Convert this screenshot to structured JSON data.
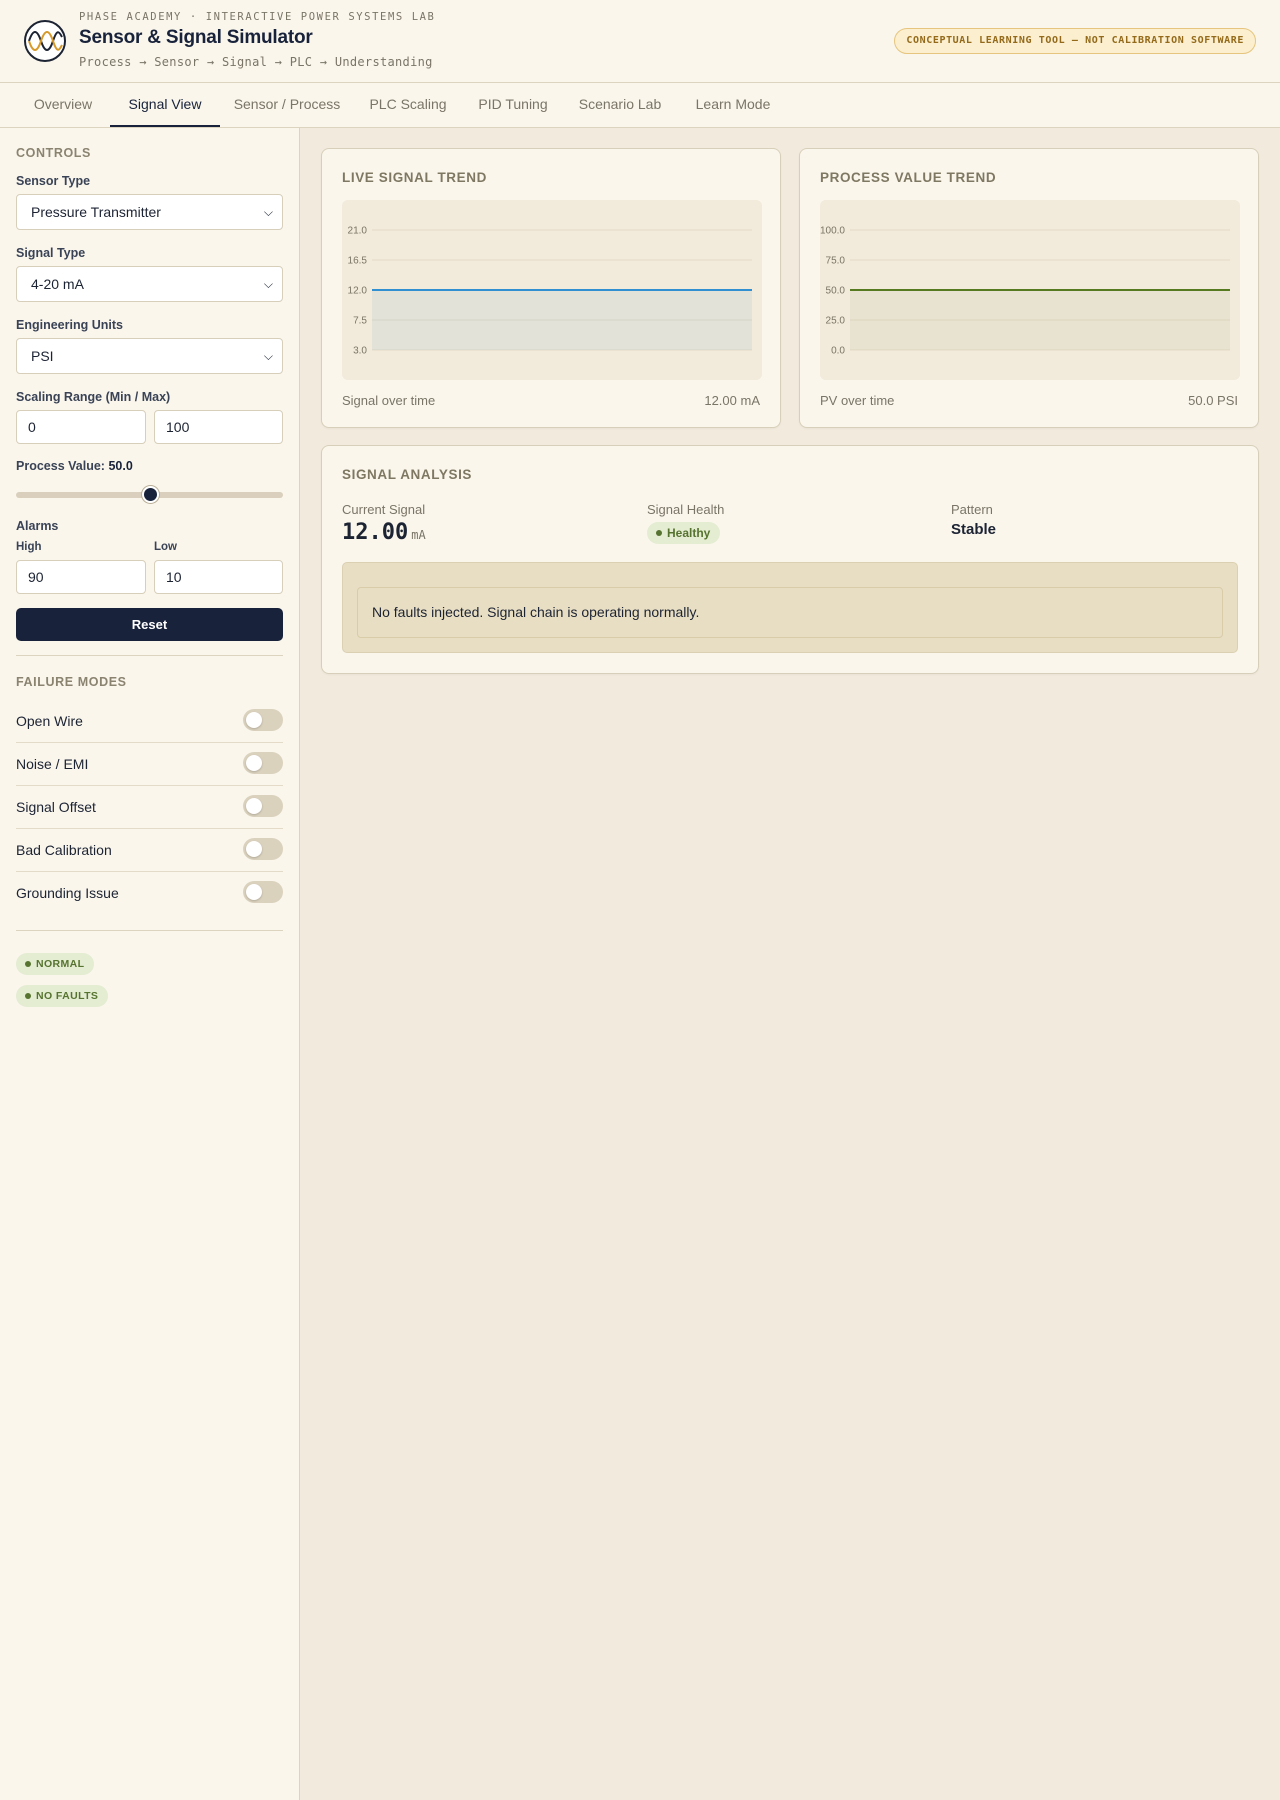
{
  "header": {
    "kicker": "PHASE ACADEMY · INTERACTIVE POWER SYSTEMS LAB",
    "title": "Sensor & Signal Simulator",
    "breadcrumb": "Process → Sensor → Signal → PLC → Understanding",
    "disclaimer": "CONCEPTUAL LEARNING TOOL — NOT CALIBRATION SOFTWARE",
    "logo_icon": "sine-wave-icon"
  },
  "tabs": [
    {
      "label": "Overview",
      "active": false
    },
    {
      "label": "Signal View",
      "active": true
    },
    {
      "label": "Sensor / Process",
      "active": false
    },
    {
      "label": "PLC Scaling",
      "active": false
    },
    {
      "label": "PID Tuning",
      "active": false
    },
    {
      "label": "Scenario Lab",
      "active": false
    },
    {
      "label": "Learn Mode",
      "active": false
    }
  ],
  "sidebar": {
    "controls_title": "CONTROLS",
    "sensor_type_label": "Sensor Type",
    "sensor_type_value": "Pressure Transmitter",
    "signal_type_label": "Signal Type",
    "signal_type_value": "4-20 mA",
    "units_label": "Engineering Units",
    "units_value": "PSI",
    "scaling_label": "Scaling Range (Min / Max)",
    "scaling_min": "0",
    "scaling_max": "100",
    "pv_label": "Process Value:",
    "pv_value": "50.0",
    "pv_fraction": 0.5,
    "alarms_label": "Alarms",
    "alarm_high_label": "High",
    "alarm_high_value": "90",
    "alarm_low_label": "Low",
    "alarm_low_value": "10",
    "reset_label": "Reset",
    "failure_title": "FAILURE MODES",
    "failure_modes": [
      {
        "label": "Open Wire",
        "on": false
      },
      {
        "label": "Noise / EMI",
        "on": false
      },
      {
        "label": "Signal Offset",
        "on": false
      },
      {
        "label": "Bad Calibration",
        "on": false
      },
      {
        "label": "Grounding Issue",
        "on": false
      }
    ],
    "status_badges": [
      "NORMAL",
      "NO FAULTS"
    ]
  },
  "signal_card": {
    "title": "LIVE SIGNAL TREND",
    "foot_left": "Signal over time",
    "foot_right": "12.00 mA"
  },
  "pv_card": {
    "title": "PROCESS VALUE TREND",
    "foot_left": "PV over time",
    "foot_right": "50.0 PSI"
  },
  "analysis": {
    "title": "SIGNAL ANALYSIS",
    "current_label": "Current Signal",
    "current_value": "12.00",
    "current_unit": "mA",
    "health_label": "Signal Health",
    "health_value": "Healthy",
    "pattern_label": "Pattern",
    "pattern_value": "Stable",
    "fault_message": "No faults injected. Signal chain is operating normally."
  },
  "colors": {
    "signal_line": "#2f8fd0",
    "pv_line": "#557a1f",
    "accent_dark": "#18223a",
    "healthy_green": "#56732f"
  },
  "chart_data": [
    {
      "type": "area",
      "title": "LIVE SIGNAL TREND",
      "xlabel": "Signal over time",
      "ylabel": "",
      "yticks": [
        "21.0",
        "16.5",
        "12.0",
        "7.5",
        "3.0"
      ],
      "ylim": [
        3.0,
        21.0
      ],
      "series": [
        {
          "values": [
            12.0,
            12.0,
            12.0,
            12.0,
            12.0,
            12.0,
            12.0,
            12.0,
            12.0,
            12.0
          ]
        }
      ],
      "grid": true
    },
    {
      "type": "area",
      "title": "PROCESS VALUE TREND",
      "xlabel": "PV over time",
      "ylabel": "",
      "yticks": [
        "100.0",
        "75.0",
        "50.0",
        "25.0",
        "0.0"
      ],
      "ylim": [
        0.0,
        100.0
      ],
      "series": [
        {
          "values": [
            50.0,
            50.0,
            50.0,
            50.0,
            50.0,
            50.0,
            50.0,
            50.0,
            50.0,
            50.0
          ]
        }
      ],
      "grid": true
    }
  ]
}
